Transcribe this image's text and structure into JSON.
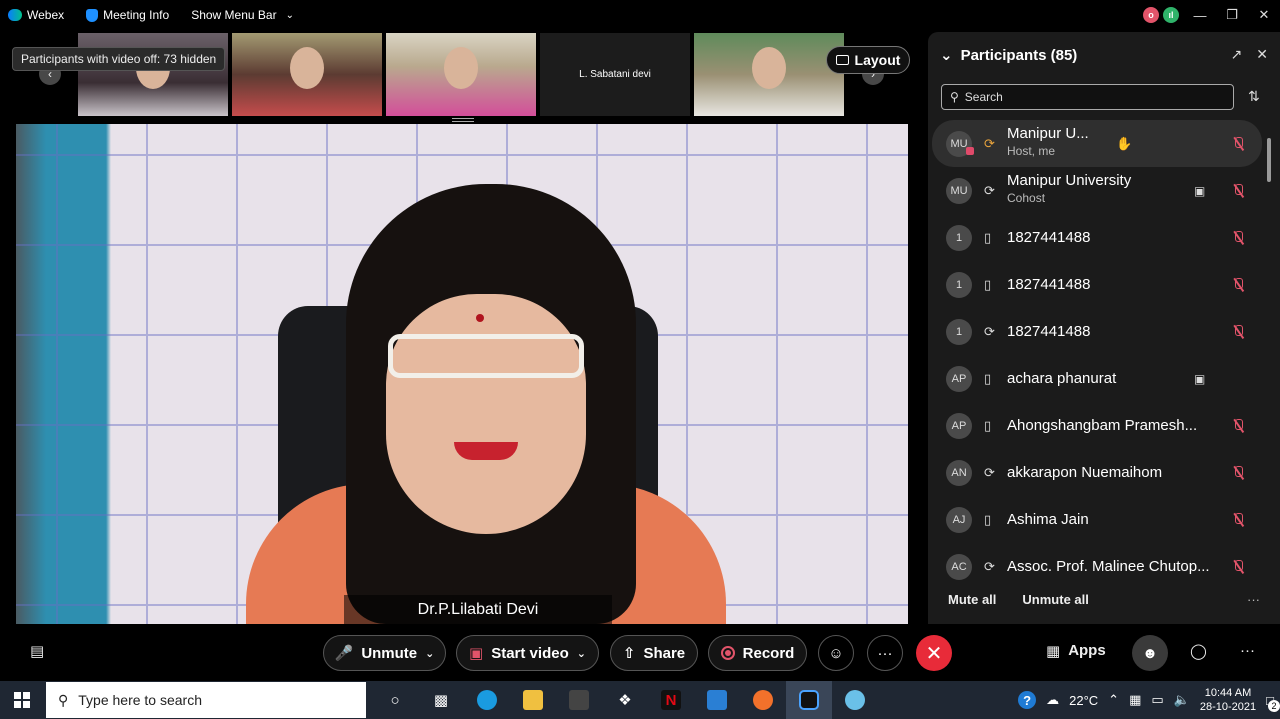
{
  "menubar": {
    "app_name": "Webex",
    "meeting_info": "Meeting Info",
    "show_menu_bar": "Show Menu Bar"
  },
  "thumbnails": {
    "tooltip": "Participants with video off: 73 hidden",
    "items": [
      {
        "label": ""
      },
      {
        "label": ""
      },
      {
        "label": ""
      },
      {
        "label": "L. Sabatani devi"
      },
      {
        "label": ""
      }
    ],
    "layout_label": "Layout"
  },
  "main_video": {
    "speaker_name": "Dr.P.Lilabati Devi"
  },
  "participants": {
    "title": "Participants (85)",
    "search_placeholder": "Search",
    "list": [
      {
        "initials": "MU",
        "name": "Manipur U...",
        "sub": "Host, me"
      },
      {
        "initials": "MU",
        "name": "Manipur University",
        "sub": "Cohost"
      },
      {
        "initials": "1",
        "name": "1827441488",
        "sub": ""
      },
      {
        "initials": "1",
        "name": "1827441488",
        "sub": ""
      },
      {
        "initials": "1",
        "name": "1827441488",
        "sub": ""
      },
      {
        "initials": "AP",
        "name": "achara phanurat",
        "sub": ""
      },
      {
        "initials": "AP",
        "name": "Ahongshangbam Pramesh...",
        "sub": ""
      },
      {
        "initials": "AN",
        "name": "akkarapon Nuemaihom",
        "sub": ""
      },
      {
        "initials": "AJ",
        "name": "Ashima Jain",
        "sub": ""
      },
      {
        "initials": "AC",
        "name": "Assoc. Prof. Malinee Chutop...",
        "sub": ""
      }
    ],
    "mute_all": "Mute all",
    "unmute_all": "Unmute all"
  },
  "controls": {
    "unmute": "Unmute",
    "start_video": "Start video",
    "share": "Share",
    "record": "Record",
    "apps": "Apps"
  },
  "taskbar": {
    "search_placeholder": "Type here to search",
    "temperature": "22°C",
    "time": "10:44 AM",
    "date": "28-10-2021",
    "notification_count": "2"
  },
  "colors": {
    "accent_red": "#e82b39",
    "mic_off_red": "#e2546a",
    "panel_bg": "#1b1b1b"
  }
}
